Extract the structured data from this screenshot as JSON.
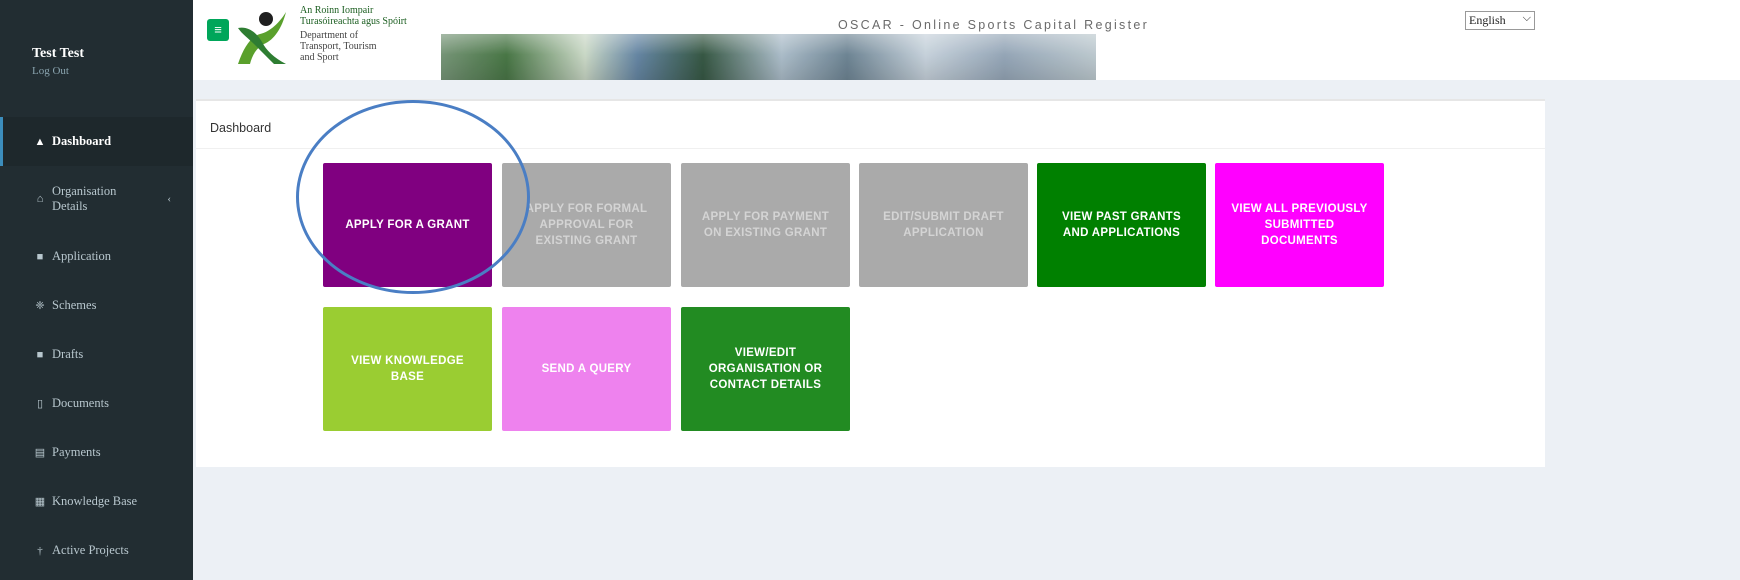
{
  "user": {
    "name": "Test Test",
    "logout": "Log Out"
  },
  "sidebar": {
    "items": [
      {
        "label": "Dashboard",
        "icon": "dashboard-icon",
        "glyph": "▲"
      },
      {
        "label": "Organisation Details",
        "icon": "home-icon",
        "glyph": "⌂",
        "chevron": "‹"
      },
      {
        "label": "Application",
        "icon": "folder-icon",
        "glyph": "■"
      },
      {
        "label": "Schemes",
        "icon": "sitemap-icon",
        "glyph": "❈"
      },
      {
        "label": "Drafts",
        "icon": "folder-open-icon",
        "glyph": "■"
      },
      {
        "label": "Documents",
        "icon": "file-icon",
        "glyph": "▯"
      },
      {
        "label": "Payments",
        "icon": "credit-card-icon",
        "glyph": "▤"
      },
      {
        "label": "Knowledge Base",
        "icon": "book-icon",
        "glyph": "▦"
      },
      {
        "label": "Active Projects",
        "icon": "thumbtack-icon",
        "glyph": "†"
      }
    ]
  },
  "header": {
    "toggle_glyph": "≡",
    "logo_irish": "An Roinn Iompair Turasóireachta agus Spóirt",
    "logo_english": "Department of Transport, Tourism and Sport",
    "title": "OSCAR - Online Sports Capital Register",
    "language": "English"
  },
  "content": {
    "title": "Dashboard",
    "tiles": [
      {
        "label": "APPLY FOR A GRANT",
        "bg": "#800080",
        "fg": "#ffffff"
      },
      {
        "label": "APPLY FOR FORMAL APPROVAL FOR EXISTING GRANT",
        "bg": "#aaaaaa",
        "fg": "#d4d4d4"
      },
      {
        "label": "APPLY FOR PAYMENT ON EXISTING GRANT",
        "bg": "#aaaaaa",
        "fg": "#d4d4d4"
      },
      {
        "label": "EDIT/SUBMIT DRAFT APPLICATION",
        "bg": "#aaaaaa",
        "fg": "#d4d4d4"
      },
      {
        "label": "VIEW PAST GRANTS AND APPLICATIONS",
        "bg": "#008000",
        "fg": "#ffffff"
      },
      {
        "label": "VIEW ALL PREVIOUSLY SUBMITTED DOCUMENTS",
        "bg": "#ff00ff",
        "fg": "#ffffff"
      },
      {
        "label": "VIEW KNOWLEDGE BASE",
        "bg": "#9acd32",
        "fg": "#ffffff"
      },
      {
        "label": "SEND A QUERY",
        "bg": "#ee82ee",
        "fg": "#ffffff"
      },
      {
        "label": "VIEW/EDIT ORGANISATION OR CONTACT DETAILS",
        "bg": "#228b22",
        "fg": "#ffffff"
      }
    ]
  },
  "colors": {
    "sidebar_bg": "#222d32",
    "accent": "#3c8dbc",
    "toggle_green": "#00a65a",
    "highlight_circle": "#4a7ec4"
  }
}
